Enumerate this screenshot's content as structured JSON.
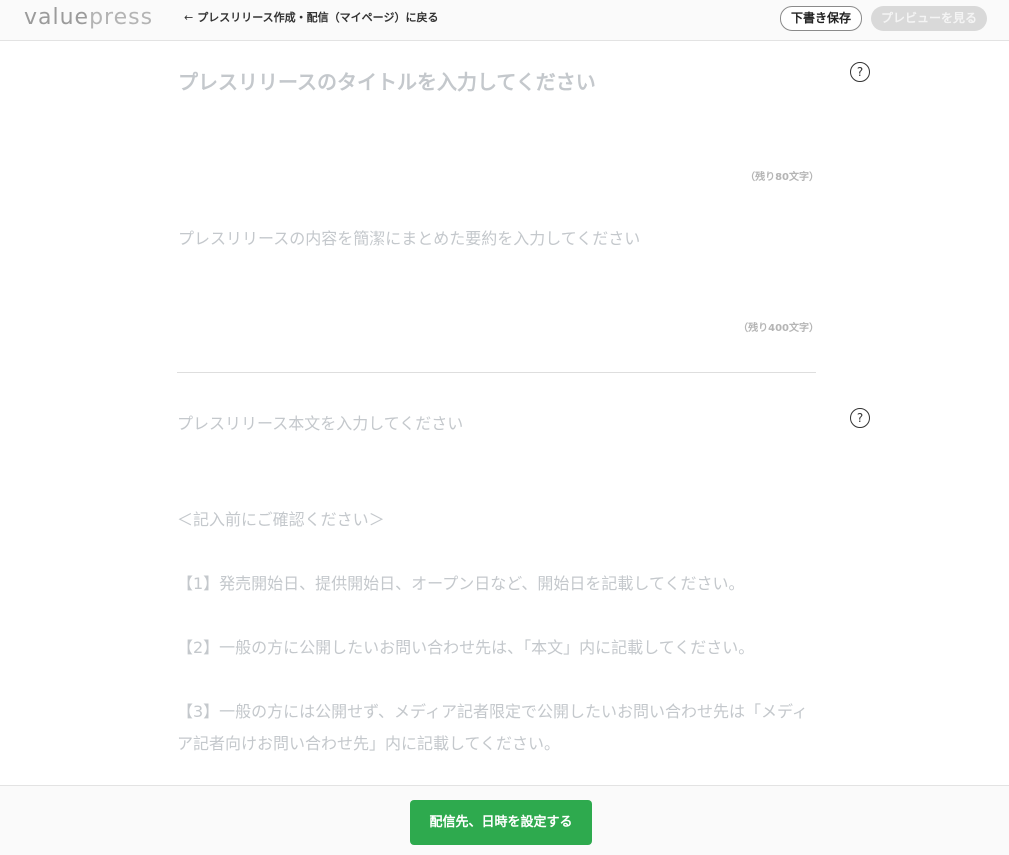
{
  "header": {
    "logo_value": "value",
    "logo_press": "press",
    "back_arrow_icon": "arrow-left-icon",
    "back_label": "プレスリリース作成・配信（マイページ）に戻る",
    "draft_label": "下書き保存",
    "preview_label": "プレビューを見る"
  },
  "editor": {
    "title_placeholder": "プレスリリースのタイトルを入力してください",
    "title_counter": "（残り80文字）",
    "summary_placeholder": "プレスリリースの内容を簡潔にまとめた要約を入力してください",
    "summary_counter": "（残り400文字）",
    "body_placeholder": "プレスリリース本文を入力してください",
    "help_icon_symbol": "?",
    "notes": [
      "＜記入前にご確認ください＞",
      "【1】発売開始日、提供開始日、オープン日など、開始日を記載してください。",
      "【2】一般の方に公開したいお問い合わせ先は、「本文」内に記載してください。",
      "【3】一般の方には公開せず、メディア記者限定で公開したいお問い合わせ先は「メディア記者向けお問い合わせ先」内に記載してください。"
    ]
  },
  "footer": {
    "submit_label": "配信先、日時を設定する"
  },
  "colors": {
    "primary": "#2eaa4e",
    "placeholder": "#c4c8cc",
    "disabled_button": "#d9d9d9"
  }
}
